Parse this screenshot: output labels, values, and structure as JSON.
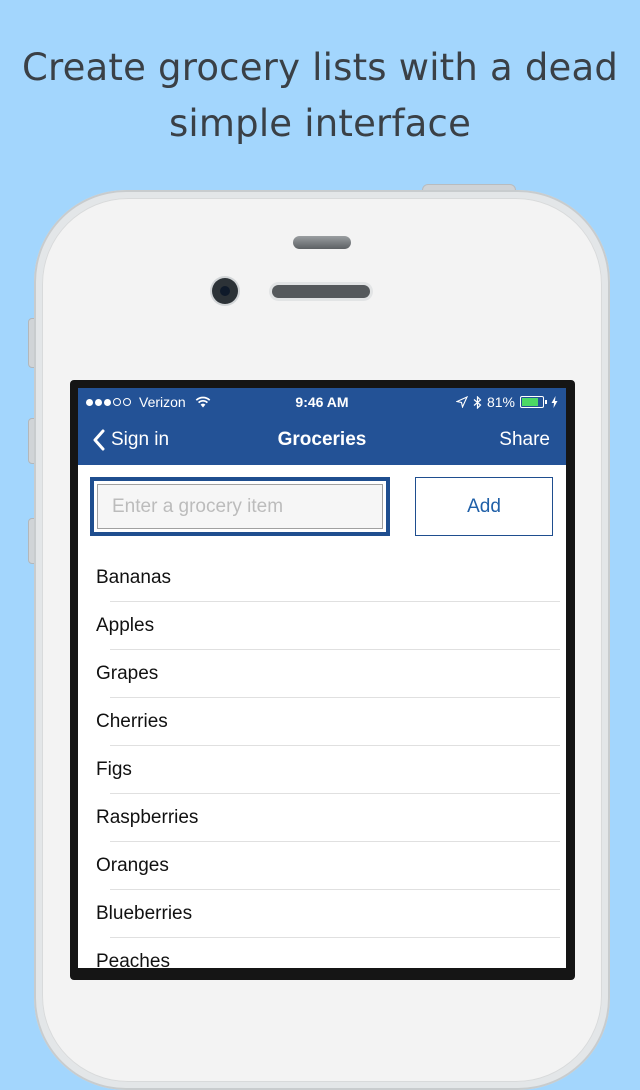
{
  "headline": {
    "line1": "Create grocery lists with a dead",
    "line2": "simple interface"
  },
  "status_bar": {
    "carrier": "Verizon",
    "time": "9:46 AM",
    "battery": "81%",
    "battery_level": 0.81,
    "signal_dots_filled": 3,
    "signal_dots_total": 5
  },
  "nav": {
    "back_label": "Sign in",
    "title": "Groceries",
    "share_label": "Share"
  },
  "form": {
    "input_value": "",
    "input_placeholder": "Enter a grocery item",
    "add_label": "Add"
  },
  "items": [
    "Bananas",
    "Apples",
    "Grapes",
    "Cherries",
    "Figs",
    "Raspberries",
    "Oranges",
    "Blueberries",
    "Peaches"
  ],
  "colors": {
    "background": "#a3d6fd",
    "nav_bar": "#235296",
    "accent": "#1f4e8f",
    "battery_fill": "#4cd964"
  }
}
